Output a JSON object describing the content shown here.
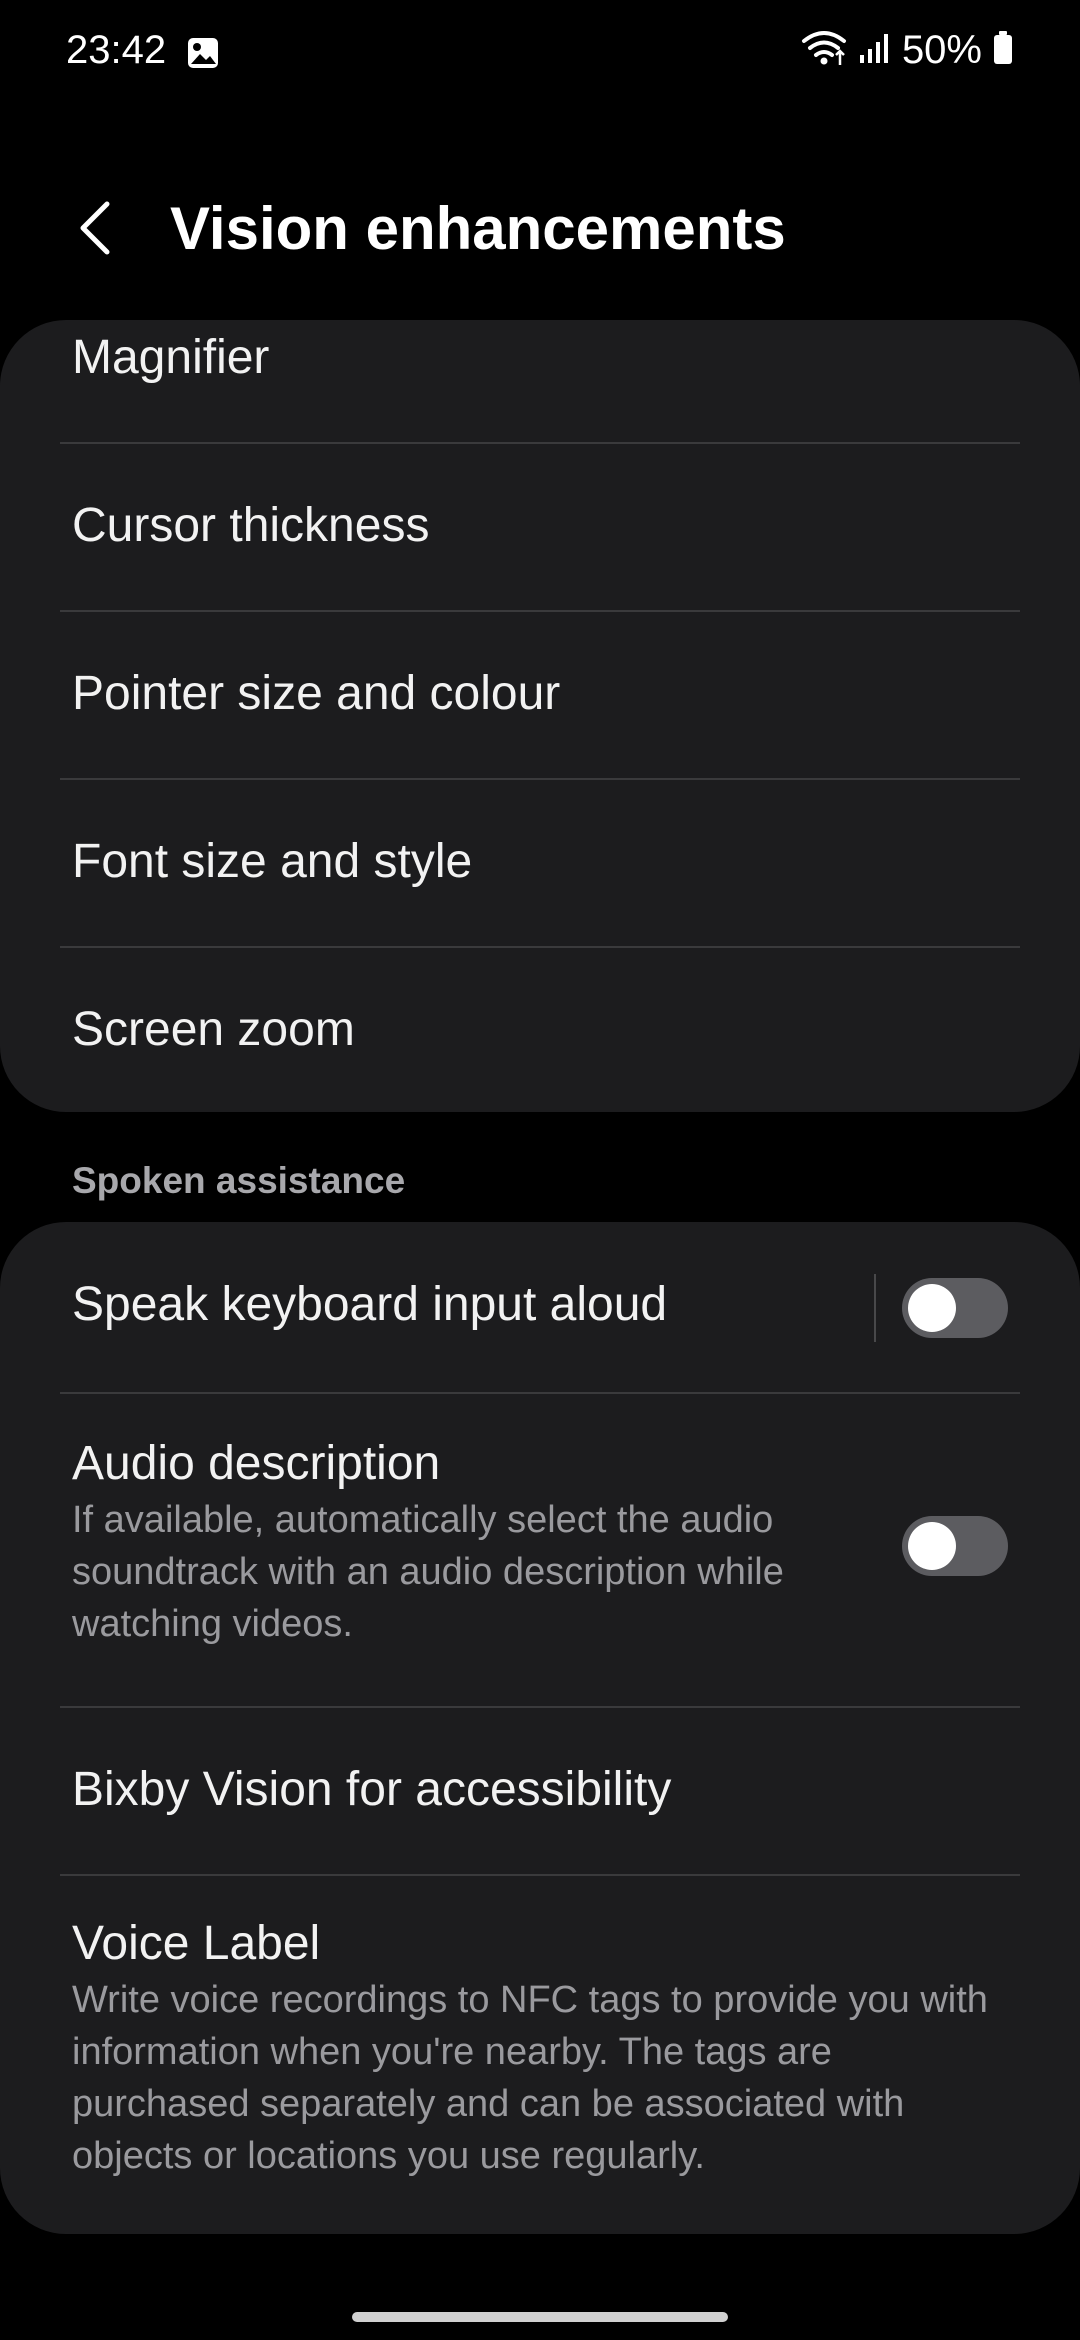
{
  "status_bar": {
    "time": "23:42",
    "battery": "50%",
    "icons": [
      "gallery-icon",
      "wifi-icon",
      "signal-icon",
      "battery-icon"
    ]
  },
  "header": {
    "title": "Vision enhancements",
    "back_icon": "chevron-left-icon"
  },
  "group1": {
    "items": [
      {
        "title": "Magnifier"
      },
      {
        "title": "Cursor thickness"
      },
      {
        "title": "Pointer size and colour"
      },
      {
        "title": "Font size and style"
      },
      {
        "title": "Screen zoom"
      }
    ]
  },
  "section_spoken": {
    "label": "Spoken assistance"
  },
  "group2": {
    "speak_keyboard": {
      "title": "Speak keyboard input aloud",
      "toggle_on": false
    },
    "audio_description": {
      "title": "Audio description",
      "desc": "If available, automatically select the audio soundtrack with an audio description while watching videos.",
      "toggle_on": false
    },
    "bixby_vision": {
      "title": "Bixby Vision for accessibility"
    },
    "voice_label": {
      "title": "Voice Label",
      "desc": "Write voice recordings to NFC tags to provide you with information when you're nearby. The tags are purchased separately and can be associated with objects or locations you use regularly."
    }
  },
  "colors": {
    "background": "#000000",
    "card": "#1c1c1e",
    "divider": "#3a3a3c",
    "toggle_off": "#5c5c60",
    "secondary_text": "#9a9a9e"
  }
}
